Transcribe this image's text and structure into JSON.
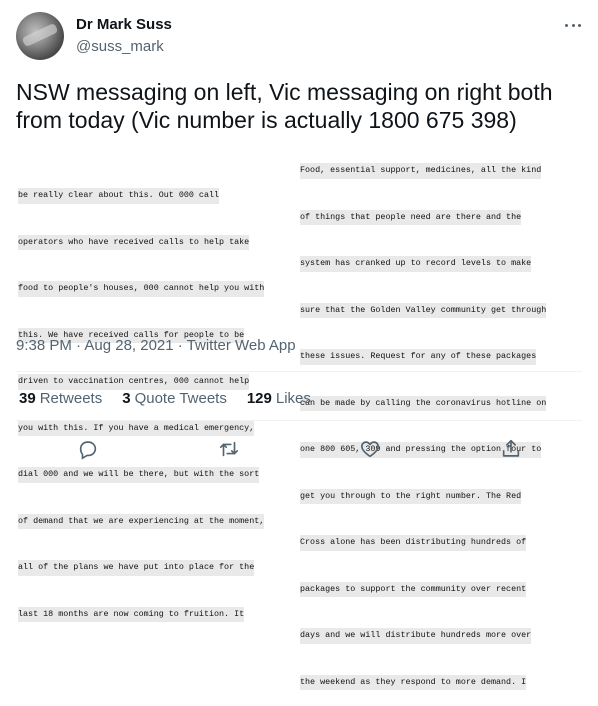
{
  "author": {
    "display_name": "Dr Mark Suss",
    "handle": "@suss_mark"
  },
  "tweet": {
    "text": "NSW messaging on left, Vic messaging on right both from today (Vic number is actually 1800 675 398)",
    "image_left_lines": [
      "be really clear about this. Out 000 call",
      "operators who have received calls to help take",
      "food to people's houses, 000 cannot help you with",
      "this. We have received calls for people to be",
      "driven to vaccination centres, 000 cannot help",
      "you with this. If you have a medical emergency,",
      "dial 000 and we will be there, but with the sort",
      "of demand that we are experiencing at the moment,",
      "all of the plans we have put into place for the",
      "last 18 months are now coming to fruition. It"
    ],
    "image_right_lines": [
      "Food, essential support, medicines, all the kind",
      "of things that people need are there and the",
      "system has cranked up to record levels to make",
      "sure that the Golden Valley community get through",
      "these issues. Request for any of these packages",
      "can be made by calling the coronavirus hotline on",
      "one 800 605, 309 and pressing the option four to",
      "get you through to the right number. The Red",
      "Cross alone has been distributing hundreds of",
      "packages to support the community over recent",
      "days and we will distribute hundreds more over",
      "the weekend as they respond to more demand. I"
    ],
    "meta": "9:38 PM · Aug 28, 2021 · Twitter Web App"
  },
  "stats": [
    {
      "count": "39",
      "label": "Retweets"
    },
    {
      "count": "3",
      "label": "Quote Tweets"
    },
    {
      "count": "129",
      "label": "Likes"
    }
  ],
  "icons": {
    "more": "more-horizontal-icon",
    "reply": "reply-icon",
    "retweet": "retweet-icon",
    "like": "heart-icon",
    "share": "share-icon"
  },
  "colors": {
    "secondary_text": "#536471",
    "primary_text": "#0f1419",
    "divider": "#eff3f4"
  }
}
